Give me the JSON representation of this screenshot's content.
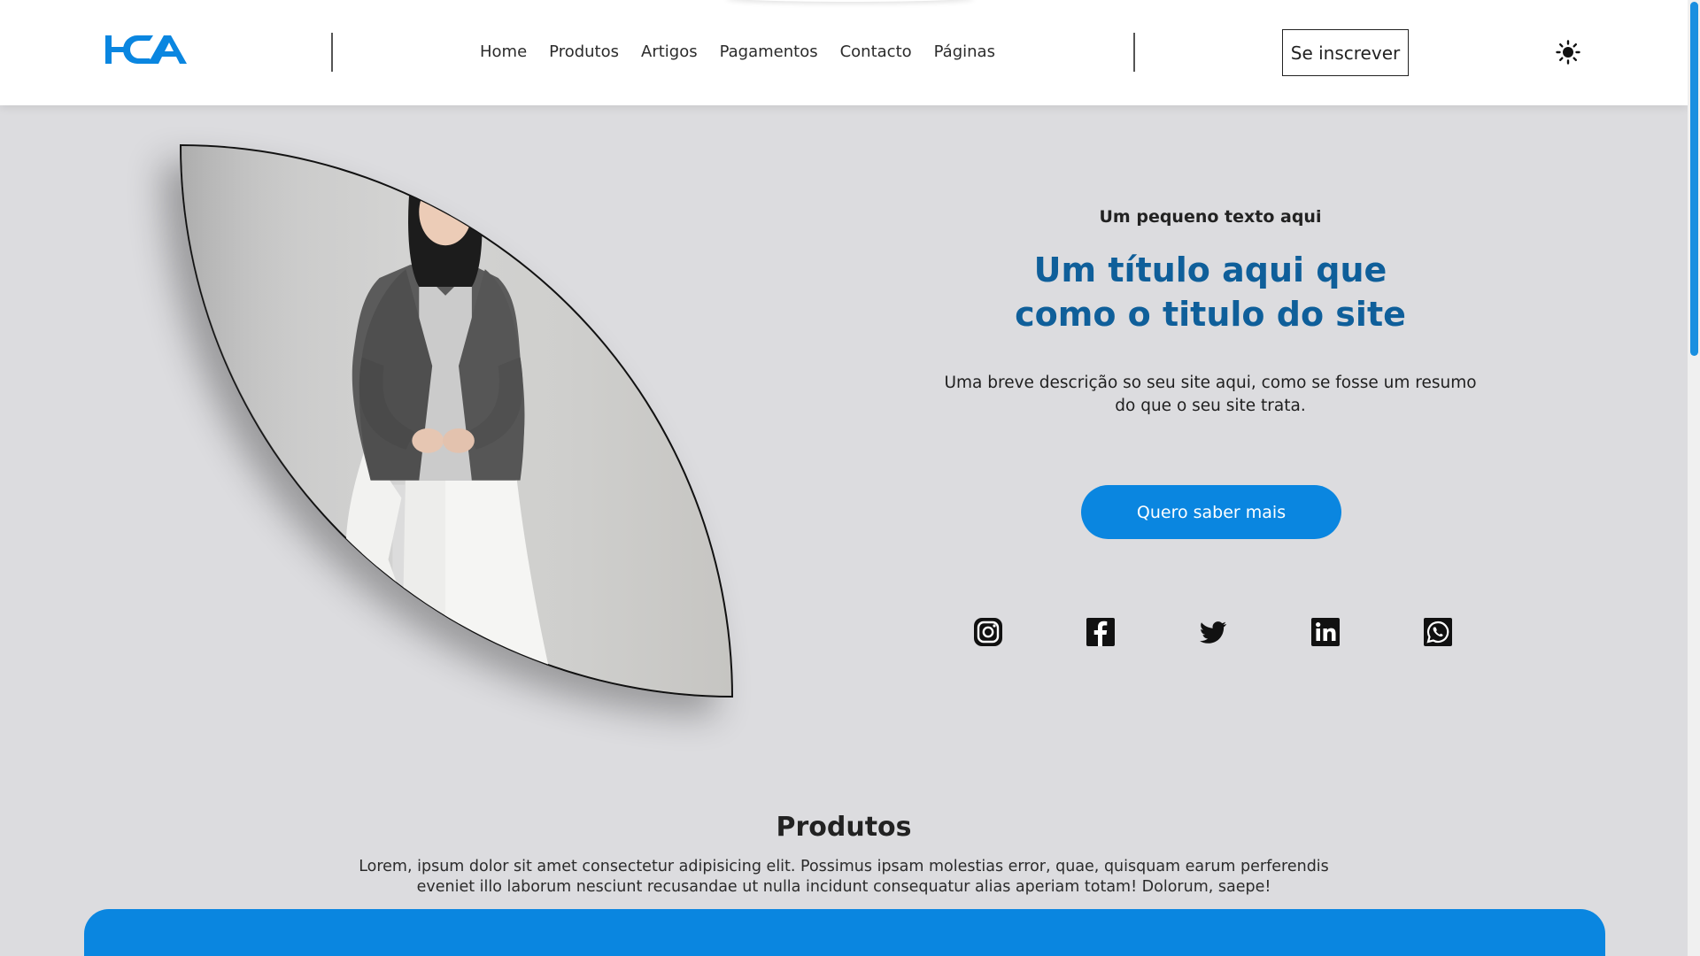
{
  "header": {
    "logo_text": "HCA",
    "nav": [
      "Home",
      "Produtos",
      "Artigos",
      "Pagamentos",
      "Contacto",
      "Páginas"
    ],
    "subscribe_label": "Se inscrever",
    "theme_icon": "sun-icon"
  },
  "hero": {
    "eyebrow": "Um pequeno texto aqui",
    "title": "Um título aqui que como o titulo do site",
    "description": "Uma breve descrição so seu site aqui, como se fosse um resumo do que o seu site trata.",
    "cta_label": "Quero saber mais",
    "photo_icon": "model-photo",
    "socials": [
      "instagram-icon",
      "facebook-icon",
      "twitter-icon",
      "linkedin-icon",
      "whatsapp-icon"
    ]
  },
  "products": {
    "title": "Produtos",
    "description": "Lorem, ipsum dolor sit amet consectetur adipisicing elit. Possimus ipsam molestias error, quae, quisquam earum perferendis eveniet illo laborum nesciunt recusandae ut nulla incidunt consequatur alias aperiam totam! Dolorum, saepe!"
  },
  "colors": {
    "accent": "#0a86e0",
    "title": "#0f5f9a",
    "background": "#dcdcdf"
  }
}
